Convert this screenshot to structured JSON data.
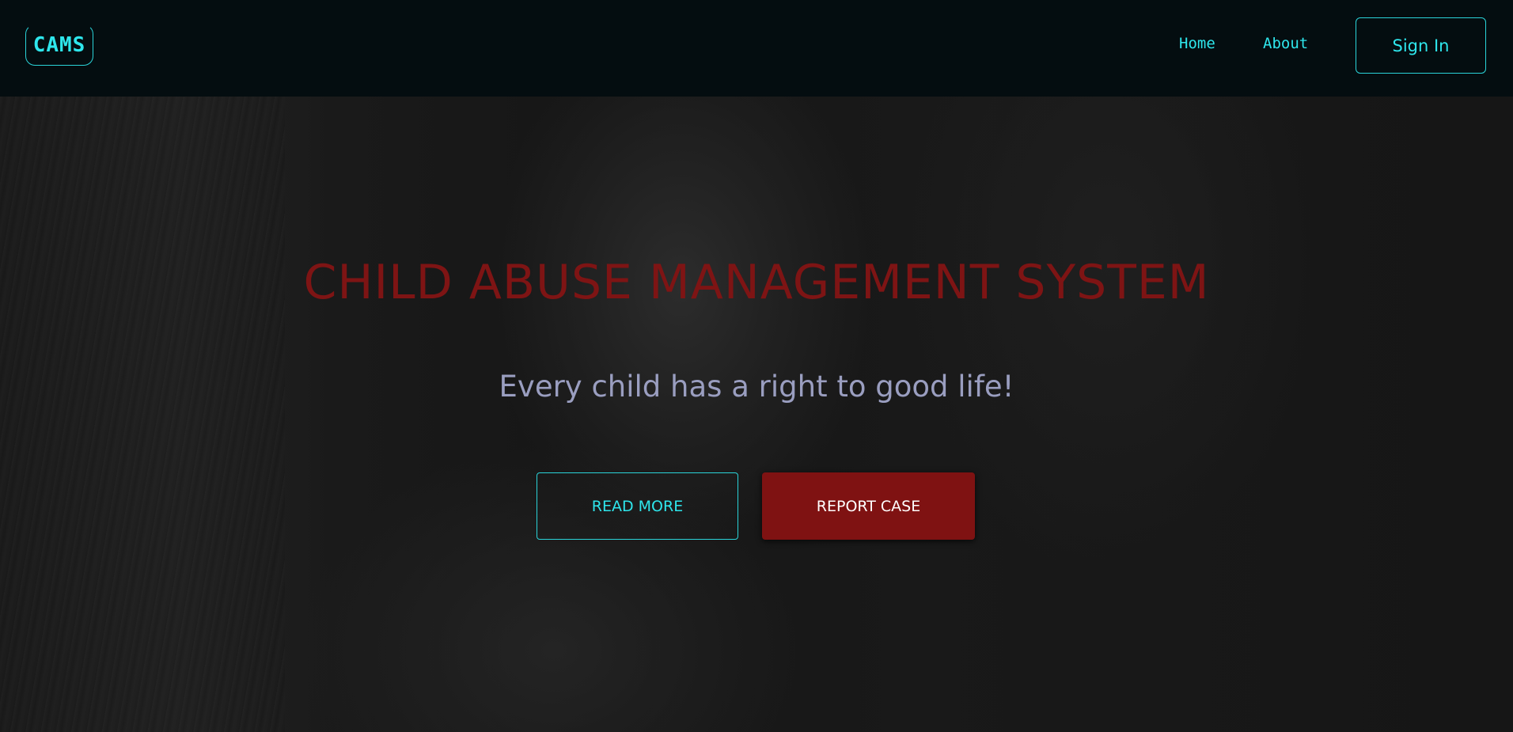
{
  "header": {
    "logo_text": "CAMS",
    "nav": [
      {
        "label": "Home"
      },
      {
        "label": "About"
      }
    ],
    "signin_label": "Sign In"
  },
  "hero": {
    "title": "CHILD ABUSE MANAGEMENT SYSTEM",
    "subtitle": "Every child has a right to good life!",
    "read_more_label": "READ MORE",
    "report_case_label": "REPORT CASE"
  },
  "colors": {
    "accent": "#2ee6ec",
    "header_bg": "#040d10",
    "title_red": "#7e1414",
    "report_button_bg": "#7f1212",
    "subtitle": "#9a9ec0"
  }
}
